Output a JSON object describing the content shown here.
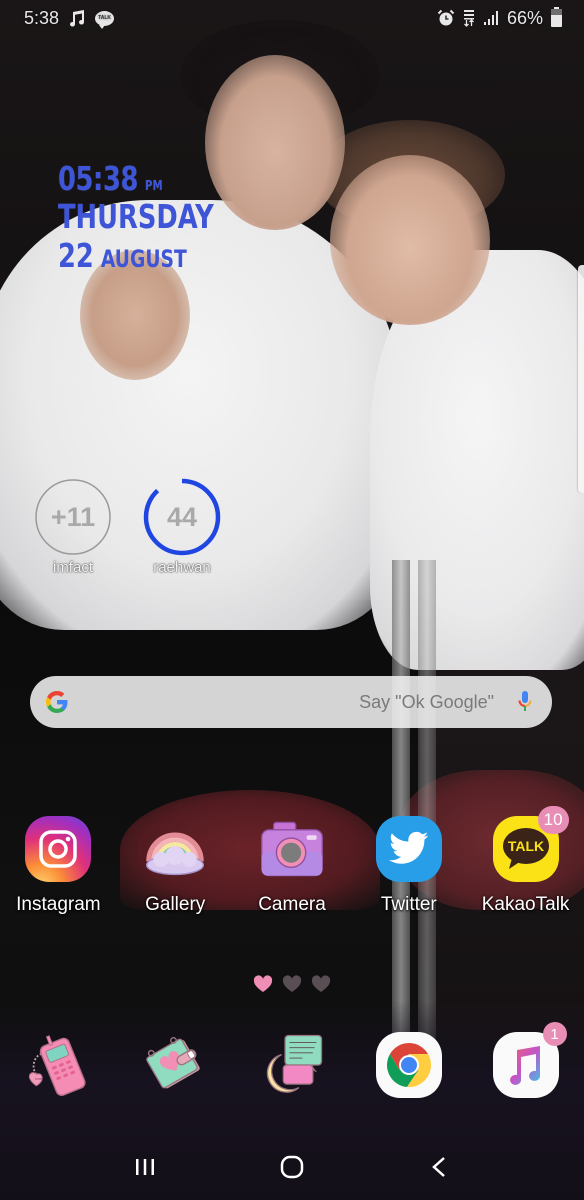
{
  "status_bar": {
    "time": "5:38",
    "left_icons": [
      "music-note-icon",
      "kakaotalk-notification-icon"
    ],
    "talk_label": "TALK",
    "right_icons": [
      "alarm-icon",
      "data-transfer-icon",
      "signal-icon",
      "battery-icon"
    ],
    "battery_percent": "66%",
    "battery_level": 0.66
  },
  "clock_widget": {
    "time": "05:38",
    "ampm": "PM",
    "day": "THURSDAY",
    "date_num": "22",
    "month": "AUGUST",
    "color": "#3d55d6"
  },
  "contacts": [
    {
      "name": "imfact",
      "count": "+11",
      "ring_progress": 0
    },
    {
      "name": "raehwan",
      "count": "44",
      "ring_progress": 0.88,
      "ring_color": "#1f46e0"
    }
  ],
  "search_bar": {
    "logo": "G",
    "placeholder": "Say \"Ok Google\"",
    "mic_icon": "microphone-icon"
  },
  "apps": [
    {
      "label": "Instagram",
      "icon": "instagram-icon"
    },
    {
      "label": "Gallery",
      "icon": "rainbow-icon"
    },
    {
      "label": "Camera",
      "icon": "camera-icon"
    },
    {
      "label": "Twitter",
      "icon": "twitter-bird-icon"
    },
    {
      "label": "KakaoTalk",
      "icon": "kakaotalk-icon",
      "icon_text": "TALK",
      "badge": "10"
    }
  ],
  "page_indicator": {
    "pages": 3,
    "current": 1,
    "active_color": "#f08fb6"
  },
  "dock": [
    {
      "name": "phone",
      "icon": "pink-flip-phone-icon",
      "charm_text": "love"
    },
    {
      "name": "contacts",
      "icon": "heart-notebook-icon"
    },
    {
      "name": "messages",
      "icon": "moon-speech-bubble-icon"
    },
    {
      "name": "chrome",
      "icon": "chrome-icon"
    },
    {
      "name": "music",
      "icon": "music-note-icon",
      "badge": "1"
    }
  ],
  "nav_bar": {
    "recents": "recents-icon",
    "home": "home-icon",
    "back": "back-icon"
  }
}
